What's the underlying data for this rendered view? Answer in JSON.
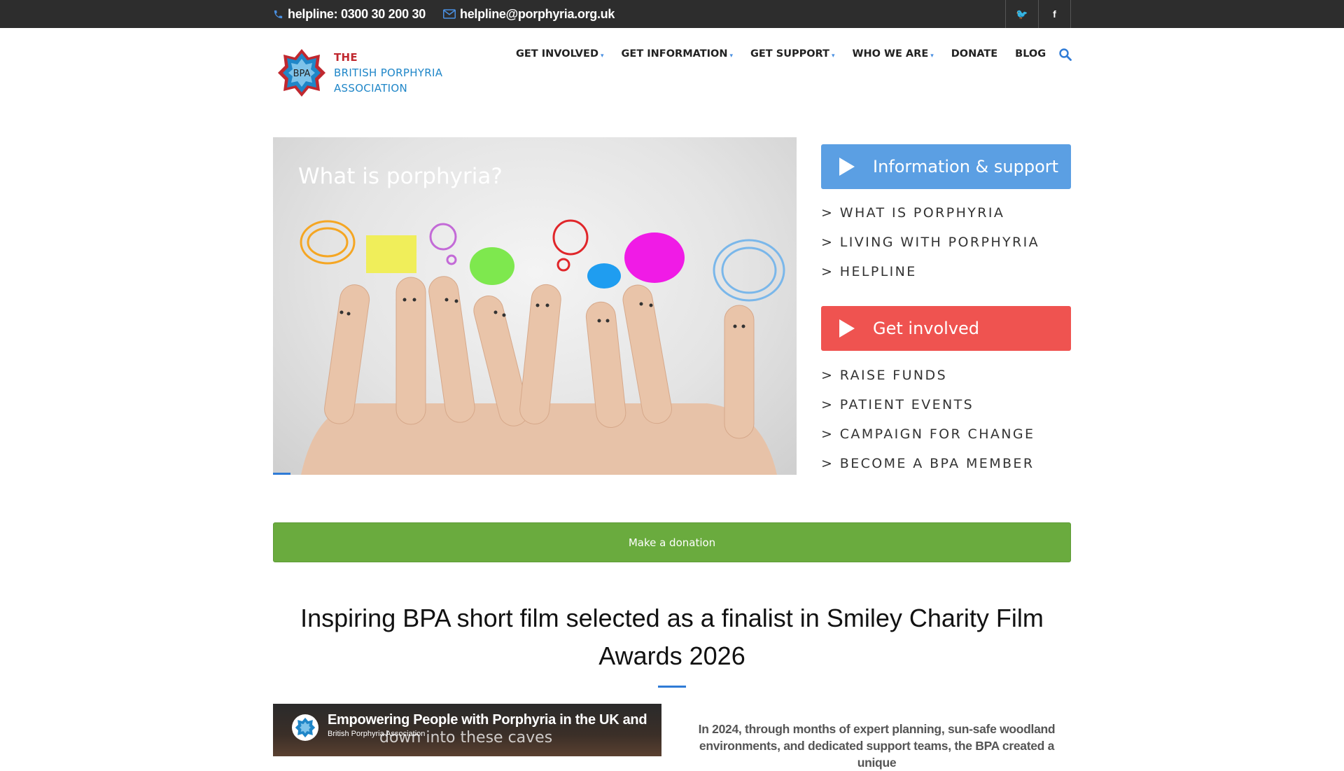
{
  "topbar": {
    "phone": "helpline: 0300 30 200 30",
    "email": "helpline@porphyria.org.uk",
    "social": [
      "twitter-icon",
      "facebook-icon"
    ],
    "social_glyphs": [
      "🐦",
      "f"
    ]
  },
  "logo": {
    "emblem_text": "BPA",
    "line1": "THE",
    "line2": "BRITISH PORPHYRIA",
    "line3": "ASSOCIATION"
  },
  "nav": {
    "items": [
      {
        "label": "GET INVOLVED",
        "dropdown": true
      },
      {
        "label": "GET INFORMATION",
        "dropdown": true
      },
      {
        "label": "GET SUPPORT",
        "dropdown": true
      },
      {
        "label": "WHO WE ARE",
        "dropdown": true
      },
      {
        "label": "DONATE",
        "dropdown": false
      },
      {
        "label": "BLOG",
        "dropdown": false
      }
    ]
  },
  "hero": {
    "caption": "What is porphyria?"
  },
  "info_panel": {
    "title": "Information & support",
    "links": [
      "> WHAT IS PORPHYRIA",
      "> LIVING WITH PORPHYRIA",
      "> HELPLINE"
    ]
  },
  "involved_panel": {
    "title": "Get involved",
    "links": [
      "> RAISE FUNDS",
      "> PATIENT EVENTS",
      "> CAMPAIGN FOR CHANGE",
      "> BECOME A BPA MEMBER"
    ]
  },
  "donate": {
    "label": "Make a donation"
  },
  "article": {
    "headline": "Inspiring BPA short film selected as a finalist in Smiley Charity Film Awards 2026",
    "video_title": "Empowering People with Porphyria in the UK and",
    "video_channel": "British Porphyria Association",
    "video_subtitle": "down into these caves",
    "excerpt": "In 2024, through months of expert planning, sun-safe woodland environments, and dedicated support teams, the BPA created a unique"
  },
  "colors": {
    "topbar": "#2d2d2d",
    "accent_blue": "#5b9fe3",
    "accent_red": "#ef5350",
    "donate_green": "#6aab3e",
    "logo_red": "#c0282f",
    "logo_blue": "#1f86c8"
  }
}
